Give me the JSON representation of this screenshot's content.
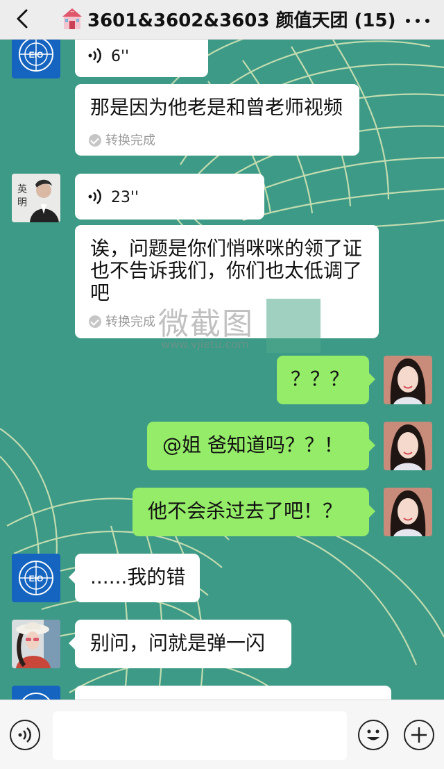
{
  "header": {
    "title": "3601&3602&3603 颜值天团 (15)"
  },
  "messages": [
    {
      "sender": "left",
      "avatar": "un-logo-avatar",
      "type": "voice",
      "duration": "6''",
      "transcript": "那是因为他老是和曾老师视频",
      "status": "转换完成"
    },
    {
      "sender": "left",
      "avatar": "yingming-avatar",
      "avatar_label": "英\n明",
      "type": "voice",
      "duration": "23''",
      "transcript": "诶，问题是你们悄咪咪的领了证也不告诉我们，你们也太低调了吧",
      "status": "转换完成"
    },
    {
      "sender": "right",
      "avatar": "self-avatar",
      "type": "text",
      "text": "？？？"
    },
    {
      "sender": "right",
      "avatar": "self-avatar",
      "type": "text",
      "text": "@姐 爸知道吗？？！"
    },
    {
      "sender": "right",
      "avatar": "self-avatar",
      "type": "text",
      "text": "他不会杀过去了吧！？"
    },
    {
      "sender": "left",
      "avatar": "un-logo-avatar",
      "type": "text",
      "text": "......我的错"
    },
    {
      "sender": "left",
      "avatar": "girl-hat-avatar",
      "type": "text",
      "text": "别问，问就是弹一闪"
    }
  ],
  "watermark": {
    "text": "微截图",
    "url": "www.vjietu.com"
  },
  "input": {
    "value": "",
    "placeholder": ""
  },
  "colors": {
    "chat_bg": "#3d9a86",
    "sent_bubble": "#95ec69",
    "received_bubble": "#ffffff",
    "header_bg": "#ededed"
  }
}
